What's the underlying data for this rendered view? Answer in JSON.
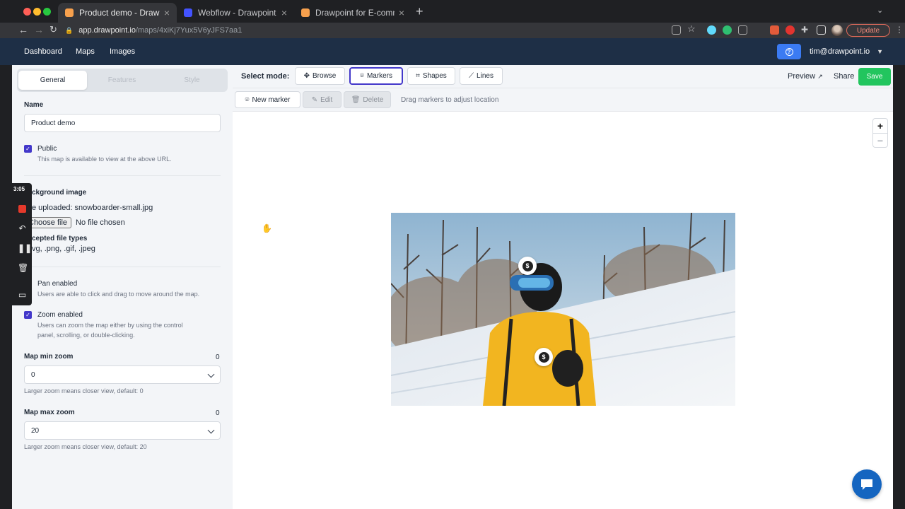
{
  "browser": {
    "tabs": [
      {
        "label": "Product demo - Drawpoint",
        "active": true
      },
      {
        "label": "Webflow - Drawpoint",
        "active": false
      },
      {
        "label": "Drawpoint for E-commerce",
        "active": false
      }
    ],
    "url_host": "app.drawpoint.io",
    "url_path": "/maps/4xiKj7Yux5V6yJFS7aa1",
    "update_label": "Update",
    "colors": {
      "close": "#ff5f57",
      "minimize": "#febc2e",
      "zoom": "#28c840",
      "update": "#f28b7c"
    }
  },
  "appnav": {
    "links": [
      "Dashboard",
      "Maps",
      "Images"
    ],
    "user": "tim@drawpoint.io"
  },
  "sidebar": {
    "tabs": [
      "General",
      "Features",
      "Style"
    ],
    "name_label": "Name",
    "name_value": "Product demo",
    "public_label": "Public",
    "public_desc": "This map is available to view at the above URL.",
    "bg_label": "ckground image",
    "file_uploaded": "e uploaded: snowboarder-small.jpg",
    "choose_file": "Choose file",
    "no_file": "No file chosen",
    "accepted_label": "cepted file types",
    "accepted_types": "vg, .png, .gif, .jpeg",
    "pan_label": "Pan enabled",
    "pan_desc": "Users are able to click and drag to move around the map.",
    "zoom_label": "Zoom enabled",
    "zoom_desc_1": "Users can zoom the map either by using the control",
    "zoom_desc_2": "panel, scrolling, or double-clicking.",
    "min_zoom_label": "Map min zoom",
    "min_zoom_count": "0",
    "min_zoom_value": "0",
    "min_zoom_help": "Larger zoom means closer view, default: 0",
    "max_zoom_label": "Map max zoom",
    "max_zoom_count": "0",
    "max_zoom_value": "20",
    "max_zoom_help": "Larger zoom means closer view, default: 20"
  },
  "recorder": {
    "time": "3:05"
  },
  "modebar": {
    "title": "Select mode:",
    "modes": [
      "Browse",
      "Markers",
      "Shapes",
      "Lines"
    ],
    "selected": "Markers",
    "preview": "Preview",
    "share": "Share",
    "save": "Save"
  },
  "actions": {
    "new_marker": "New marker",
    "edit": "Edit",
    "delete": "Delete",
    "hint": "Drag markers to adjust location"
  },
  "zoom_controls": {
    "plus": "+",
    "minus": "−"
  },
  "map": {
    "marker_symbol": "$",
    "marker_icon": "dollar-icon"
  }
}
